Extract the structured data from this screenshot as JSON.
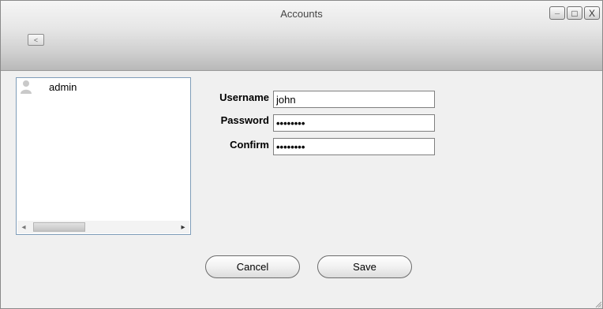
{
  "window": {
    "title": "Accounts",
    "controls": {
      "minimize_icon": "minimize-icon",
      "maximize_icon": "maximize-icon",
      "close_icon": "close-icon",
      "minimize_glyph": "_",
      "maximize_glyph": "□",
      "close_glyph": "X"
    }
  },
  "toolbar": {
    "back_icon": "chevron-left-icon",
    "back_glyph": "<"
  },
  "accounts_list": {
    "items": [
      {
        "label": "admin",
        "icon": "user-icon"
      }
    ],
    "scrollbar": {
      "left_glyph": "◂",
      "right_glyph": "▸"
    }
  },
  "form": {
    "username_label": "Username",
    "username_value": "john",
    "password_label": "Password",
    "password_value": "••••••••",
    "confirm_label": "Confirm",
    "confirm_value": "••••••••"
  },
  "buttons": {
    "cancel_label": "Cancel",
    "save_label": "Save"
  },
  "colors": {
    "titlebar_bottom": "#b9b9b9",
    "panel_background": "#f0f0f0",
    "list_border": "#7f9db9"
  }
}
